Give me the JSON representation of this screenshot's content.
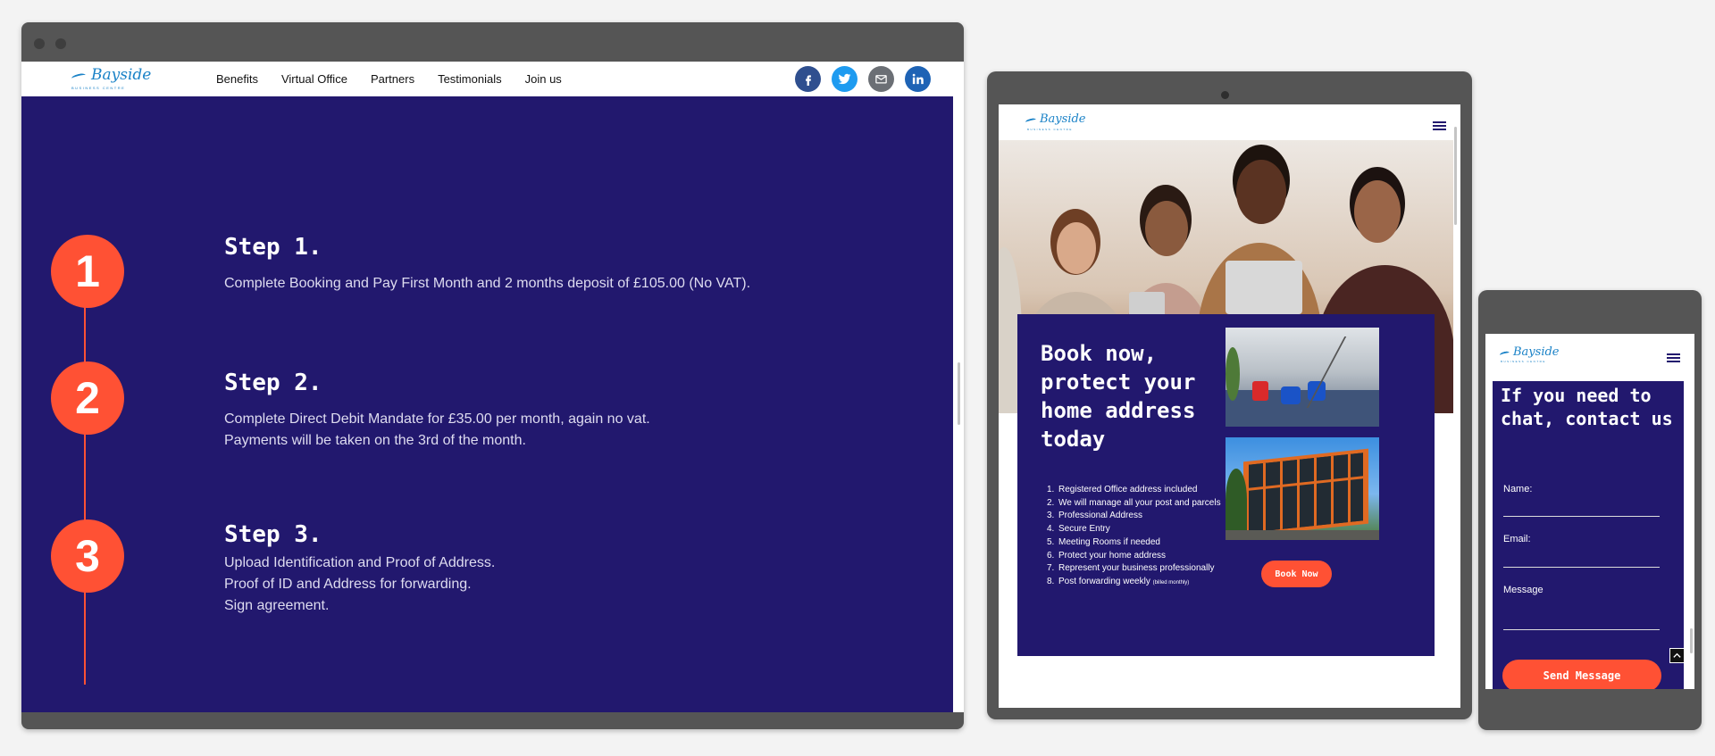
{
  "logo": {
    "script": "Bayside",
    "sub": "BUSINESS CENTRE"
  },
  "desktop": {
    "nav": [
      "Benefits",
      "Virtual Office",
      "Partners",
      "Testimonials",
      "Join us"
    ],
    "social": [
      {
        "name": "facebook",
        "glyph": "f",
        "color": "#2f4f8f"
      },
      {
        "name": "twitter",
        "glyph": "t",
        "color": "#1e9bf0"
      },
      {
        "name": "email",
        "glyph": "✉",
        "color": "#6b6f75"
      },
      {
        "name": "linkedin",
        "glyph": "in",
        "color": "#1e63b5"
      }
    ],
    "steps": [
      {
        "number": "1",
        "title": "Step 1.",
        "lines": [
          "Complete Booking and Pay First Month and 2 months deposit of £105.00 (No VAT)."
        ]
      },
      {
        "number": "2",
        "title": "Step 2.",
        "lines": [
          "Complete Direct Debit Mandate for £35.00 per month, again no vat.",
          "Payments will be taken on the 3rd of the month."
        ]
      },
      {
        "number": "3",
        "title": "Step 3.",
        "lines": [
          "Upload Identification and Proof of Address.",
          "Proof of ID and Address for forwarding.",
          "Sign agreement."
        ]
      }
    ],
    "accent": "#ff5134",
    "background": "#22186e"
  },
  "tablet": {
    "headline": "Book now, protect your home address today",
    "list": [
      "Registered Office address included",
      "We will manage all your post and parcels",
      "Professional Address",
      "Secure Entry",
      "Meeting Rooms if needed",
      "Protect your home address",
      "Represent your business professionally",
      "Post forwarding weekly"
    ],
    "list_note": "(billed monthly)",
    "book_button": "Book Now",
    "menu_icon": "hamburger-icon"
  },
  "mobile": {
    "headline": "If you need to chat, contact us",
    "fields": [
      "Name:",
      "Email:",
      "Message"
    ],
    "send_button": "Send Message",
    "top_icon": "chevron-up-icon"
  }
}
